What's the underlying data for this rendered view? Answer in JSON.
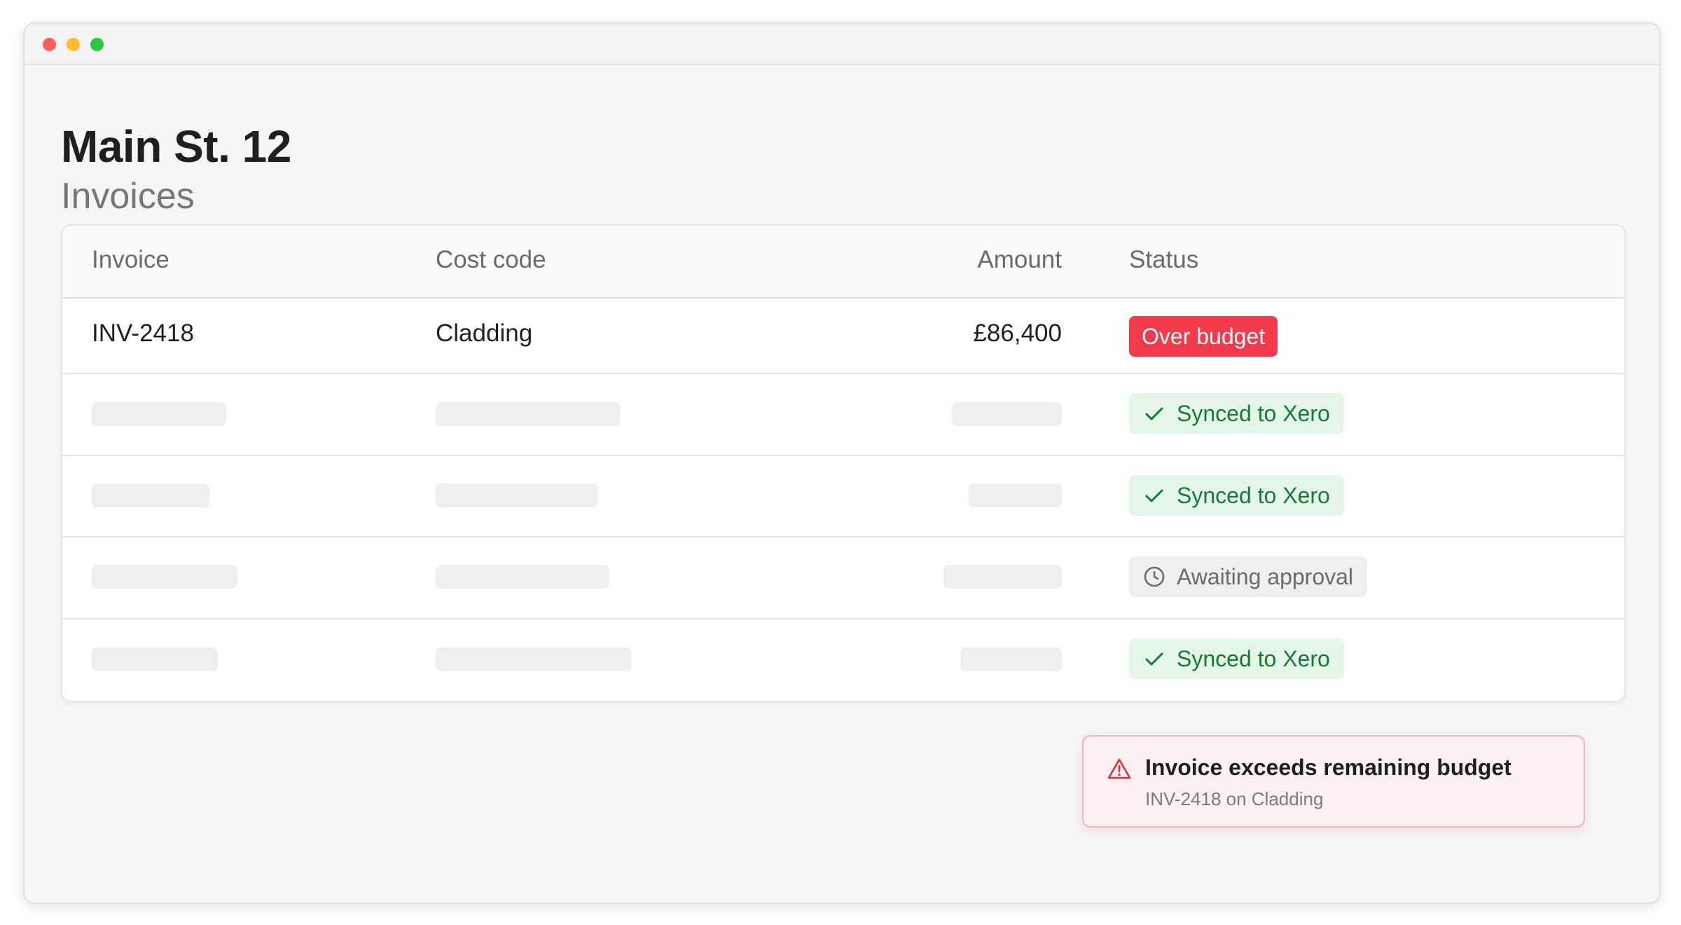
{
  "page": {
    "title": "Main St. 12",
    "subtitle": "Invoices"
  },
  "table": {
    "columns": [
      "Invoice",
      "Cost code",
      "Amount",
      "Status"
    ],
    "rows": [
      {
        "invoice": "INV-2418",
        "cost_code": "Cladding",
        "amount": "£86,400",
        "status": "Over budget",
        "status_kind": "danger",
        "status_icon": ""
      },
      {
        "invoice": "",
        "cost_code": "",
        "amount": "",
        "status": "Synced to Xero",
        "status_kind": "success",
        "status_icon": "check-icon"
      },
      {
        "invoice": "",
        "cost_code": "",
        "amount": "",
        "status": "Synced to Xero",
        "status_kind": "success",
        "status_icon": "check-icon"
      },
      {
        "invoice": "",
        "cost_code": "",
        "amount": "",
        "status": "Awaiting approval",
        "status_kind": "pending",
        "status_icon": "clock-icon"
      },
      {
        "invoice": "",
        "cost_code": "",
        "amount": "",
        "status": "Synced to Xero",
        "status_kind": "success",
        "status_icon": "check-icon"
      }
    ]
  },
  "toast": {
    "title": "Invoice exceeds remaining budget",
    "message": "INV-2418 on Cladding",
    "icon": "warning-triangle-icon"
  },
  "colors": {
    "danger": "#f23a4a",
    "success_bg": "#e4f6e8",
    "success_text": "#167a35",
    "pending_bg": "#efefef",
    "pending_text": "#6b6b6b",
    "toast_bg": "#fdf0f0",
    "toast_border": "#f4b3b8"
  }
}
